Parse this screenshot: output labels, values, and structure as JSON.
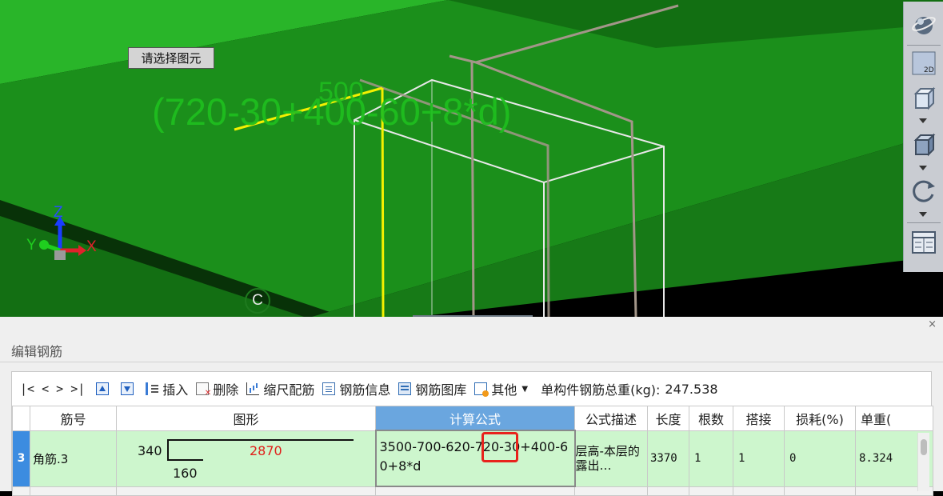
{
  "viewport": {
    "tooltip": "请选择图元",
    "formula_3d": "(720-30+400-60+8*d)",
    "dimension_3d": "500",
    "axis": {
      "z": "Z",
      "y": "Y",
      "x": "X"
    },
    "grid_label": "C"
  },
  "toolbar": {
    "icons": [
      "orbit-icon",
      "2d-view-icon",
      "3d-box-icon",
      "solid-box-icon",
      "rotate-icon",
      "properties-icon"
    ],
    "view_2d_label": "2D"
  },
  "panel": {
    "close": "×",
    "title": "编辑钢筋",
    "toolbar": {
      "nav": "|<  <  >  >|",
      "insert": "插入",
      "delete": "删除",
      "scale_rebar": "缩尺配筋",
      "rebar_info": "钢筋信息",
      "rebar_library": "钢筋图库",
      "other": "其他",
      "total_weight_label": "单构件钢筋总重(kg):",
      "total_weight_value": "247.538"
    },
    "columns": [
      "筋号",
      "图形",
      "计算公式",
      "公式描述",
      "长度",
      "根数",
      "搭接",
      "损耗(%)",
      "单重("
    ],
    "active_column": "计算公式",
    "rows": [
      {
        "row_no": "3",
        "name": "角筋.3",
        "shape": {
          "left_dim": "340",
          "middle_dim": "2870",
          "bottom_dim": "160"
        },
        "formula": "3500-700-620-720-30+400-60+8*d",
        "description": "层高-本层的露出…",
        "length": "3370",
        "count": "1",
        "splice": "1",
        "loss": "0",
        "unit_weight": "8.324"
      }
    ]
  },
  "colors": {
    "viewport_green": "#1a8a1a",
    "formula_green": "#1fbf1f",
    "active_header": "#6aa6df",
    "row_highlight": "#cdf6cd",
    "highlight_box": "#e8221c"
  }
}
